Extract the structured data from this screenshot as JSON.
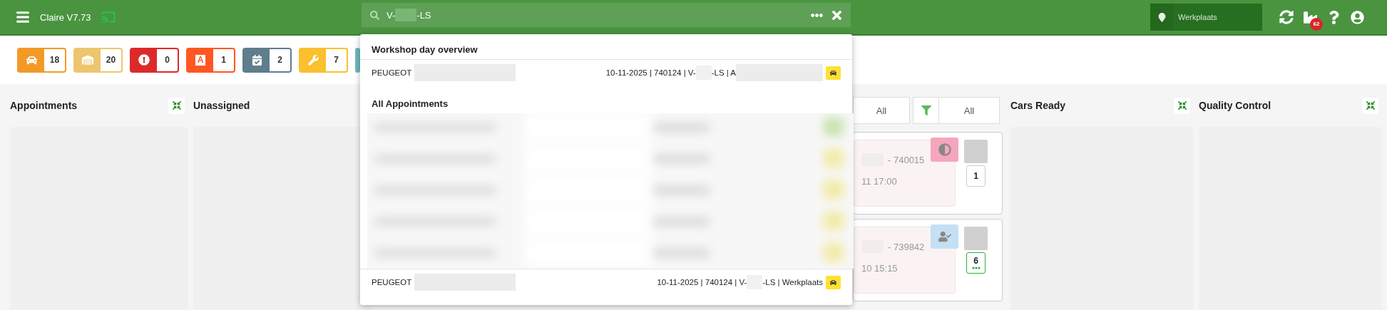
{
  "header": {
    "title": "Claire V7.73",
    "search": {
      "value_start": "V-",
      "value_end": "-LS"
    },
    "location": "Werkplaats",
    "notifications": "62"
  },
  "status_badges": [
    {
      "kind": "car",
      "count": "18",
      "color": "#f39a26"
    },
    {
      "kind": "garage",
      "count": "20",
      "color": "#eec56f"
    },
    {
      "kind": "alert",
      "count": "0",
      "color": "#dc2a2a"
    },
    {
      "kind": "letter",
      "glyph": "A",
      "count": "1",
      "color": "#ff5722"
    },
    {
      "kind": "calendar",
      "count": "2",
      "color": "#607d8b"
    },
    {
      "kind": "wrench",
      "count": "7",
      "color": "#fbc02d"
    },
    {
      "kind": "hidden",
      "color": "#6cb8bc"
    }
  ],
  "board": {
    "left_columns": [
      {
        "title": "Appointments"
      },
      {
        "title": "Unassigned"
      }
    ],
    "filters": [
      {
        "kind": "plain",
        "label": "All"
      },
      {
        "kind": "funnel",
        "label": "All"
      }
    ],
    "cards": [
      {
        "kind": "clock",
        "number": "- 740015",
        "time": "11 17:00",
        "count": "1",
        "more": false
      },
      {
        "kind": "user-check",
        "number": "- 739842",
        "time": "10 15:15",
        "count": "6",
        "more": true
      }
    ],
    "right_columns": [
      {
        "title": "Cars Ready"
      },
      {
        "title": "Quality Control"
      }
    ]
  },
  "search_results": {
    "sections": [
      {
        "title": "Workshop day overview",
        "blurred": false,
        "rows": [
          {
            "make": "PEUGEOT",
            "details": [
              "10-11-2025 | 740124 | V-",
              "-LS | A"
            ],
            "trailing_redaction": true
          }
        ]
      },
      {
        "title": "All Appointments",
        "blurred": true,
        "rows": [
          {
            "make": "PEUGEOT",
            "details": [
              "10-11-2025 | 740124 | V-",
              "-LS | Werkplaats"
            ],
            "trailing_redaction": false
          }
        ]
      }
    ]
  }
}
